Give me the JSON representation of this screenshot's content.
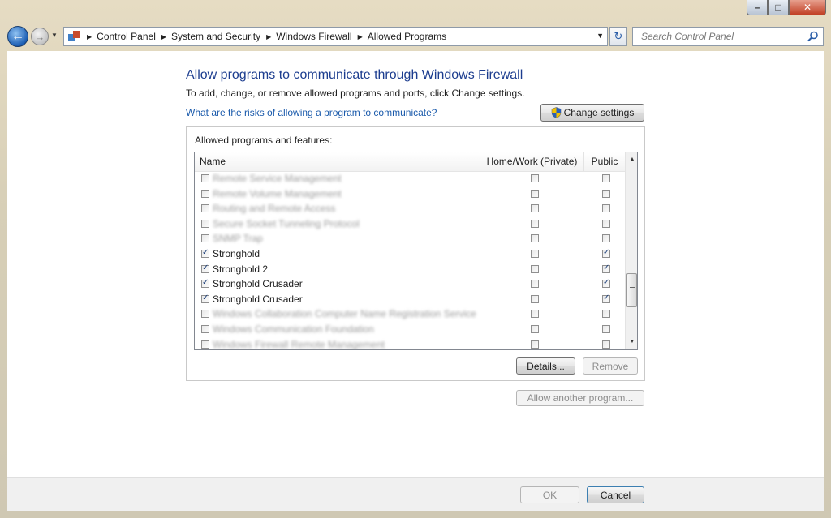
{
  "window": {
    "controls": {
      "minimize": "–",
      "maximize": "□",
      "close": "✕"
    }
  },
  "nav": {
    "breadcrumbs": [
      "Control Panel",
      "System and Security",
      "Windows Firewall",
      "Allowed Programs"
    ],
    "search_placeholder": "Search Control Panel",
    "icons": [
      "back-arrow-icon",
      "forward-arrow-icon",
      "recent-pages-dropdown-icon",
      "control-panel-icon",
      "refresh-icon",
      "search-icon"
    ]
  },
  "page": {
    "title": "Allow programs to communicate through Windows Firewall",
    "instructions": "To add, change, or remove allowed programs and ports, click Change settings.",
    "risk_link": "What are the risks of allowing a program to communicate?",
    "change_settings": "Change settings"
  },
  "programs": {
    "group_label": "Allowed programs and features:",
    "columns": {
      "name": "Name",
      "home": "Home/Work (Private)",
      "public": "Public"
    },
    "rows": [
      {
        "name": "Remote Service Management",
        "enabled": false,
        "home": false,
        "public": false,
        "blurred": true
      },
      {
        "name": "Remote Volume Management",
        "enabled": false,
        "home": false,
        "public": false,
        "blurred": true
      },
      {
        "name": "Routing and Remote Access",
        "enabled": false,
        "home": false,
        "public": false,
        "blurred": true
      },
      {
        "name": "Secure Socket Tunneling Protocol",
        "enabled": false,
        "home": false,
        "public": false,
        "blurred": true
      },
      {
        "name": "SNMP Trap",
        "enabled": false,
        "home": false,
        "public": false,
        "blurred": true
      },
      {
        "name": "Stronghold",
        "enabled": true,
        "home": false,
        "public": true,
        "blurred": false
      },
      {
        "name": "Stronghold 2",
        "enabled": true,
        "home": false,
        "public": true,
        "blurred": false
      },
      {
        "name": "Stronghold Crusader",
        "enabled": true,
        "home": false,
        "public": true,
        "blurred": false
      },
      {
        "name": "Stronghold Crusader",
        "enabled": true,
        "home": false,
        "public": true,
        "blurred": false
      },
      {
        "name": "Windows Collaboration Computer Name Registration Service",
        "enabled": false,
        "home": false,
        "public": false,
        "blurred": true
      },
      {
        "name": "Windows Communication Foundation",
        "enabled": false,
        "home": false,
        "public": false,
        "blurred": true
      },
      {
        "name": "Windows Firewall Remote Management",
        "enabled": false,
        "home": false,
        "public": false,
        "blurred": true
      }
    ],
    "details": "Details...",
    "remove": "Remove",
    "allow_another": "Allow another program..."
  },
  "footer": {
    "ok": "OK",
    "cancel": "Cancel"
  },
  "colors": {
    "title": "#1c3d8f",
    "link": "#1a5aab",
    "accent": "#1d5fb4"
  }
}
